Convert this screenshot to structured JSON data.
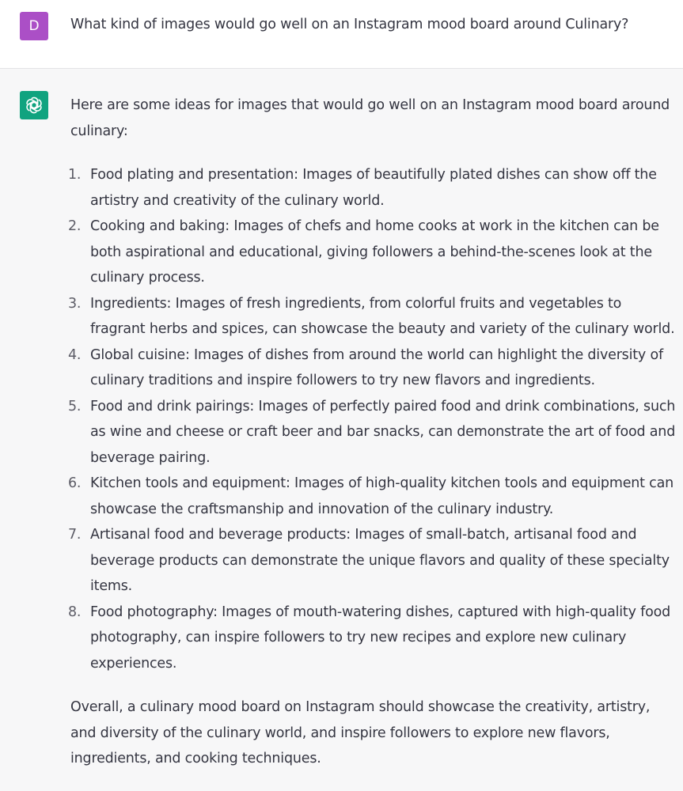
{
  "user": {
    "avatar_letter": "D",
    "avatar_color": "#ab4fc6",
    "message": "What kind of images would go well on an Instagram mood board around Culinary?"
  },
  "assistant": {
    "avatar_icon": "openai-logo-icon",
    "avatar_color": "#10a37f",
    "intro": "Here are some ideas for images that would go well on an Instagram mood board around culinary:",
    "items": [
      {
        "number": "1.",
        "text": "Food plating and presentation: Images of beautifully plated dishes can show off the artistry and creativity of the culinary world."
      },
      {
        "number": "2.",
        "text": "Cooking and baking: Images of chefs and home cooks at work in the kitchen can be both aspirational and educational, giving followers a behind-the-scenes look at the culinary process."
      },
      {
        "number": "3.",
        "text": "Ingredients: Images of fresh ingredients, from colorful fruits and vegetables to fragrant herbs and spices, can showcase the beauty and variety of the culinary world."
      },
      {
        "number": "4.",
        "text": "Global cuisine: Images of dishes from around the world can highlight the diversity of culinary traditions and inspire followers to try new flavors and ingredients."
      },
      {
        "number": "5.",
        "text": "Food and drink pairings: Images of perfectly paired food and drink combinations, such as wine and cheese or craft beer and bar snacks, can demonstrate the art of food and beverage pairing."
      },
      {
        "number": "6.",
        "text": "Kitchen tools and equipment: Images of high-quality kitchen tools and equipment can showcase the craftsmanship and innovation of the culinary industry."
      },
      {
        "number": "7.",
        "text": "Artisanal food and beverage products: Images of small-batch, artisanal food and beverage products can demonstrate the unique flavors and quality of these specialty items."
      },
      {
        "number": "8.",
        "text": "Food photography: Images of mouth-watering dishes, captured with high-quality food photography, can inspire followers to try new recipes and explore new culinary experiences."
      }
    ],
    "conclusion": "Overall, a culinary mood board on Instagram should showcase the creativity, artistry, and diversity of the culinary world, and inspire followers to explore new flavors, ingredients, and cooking techniques."
  }
}
